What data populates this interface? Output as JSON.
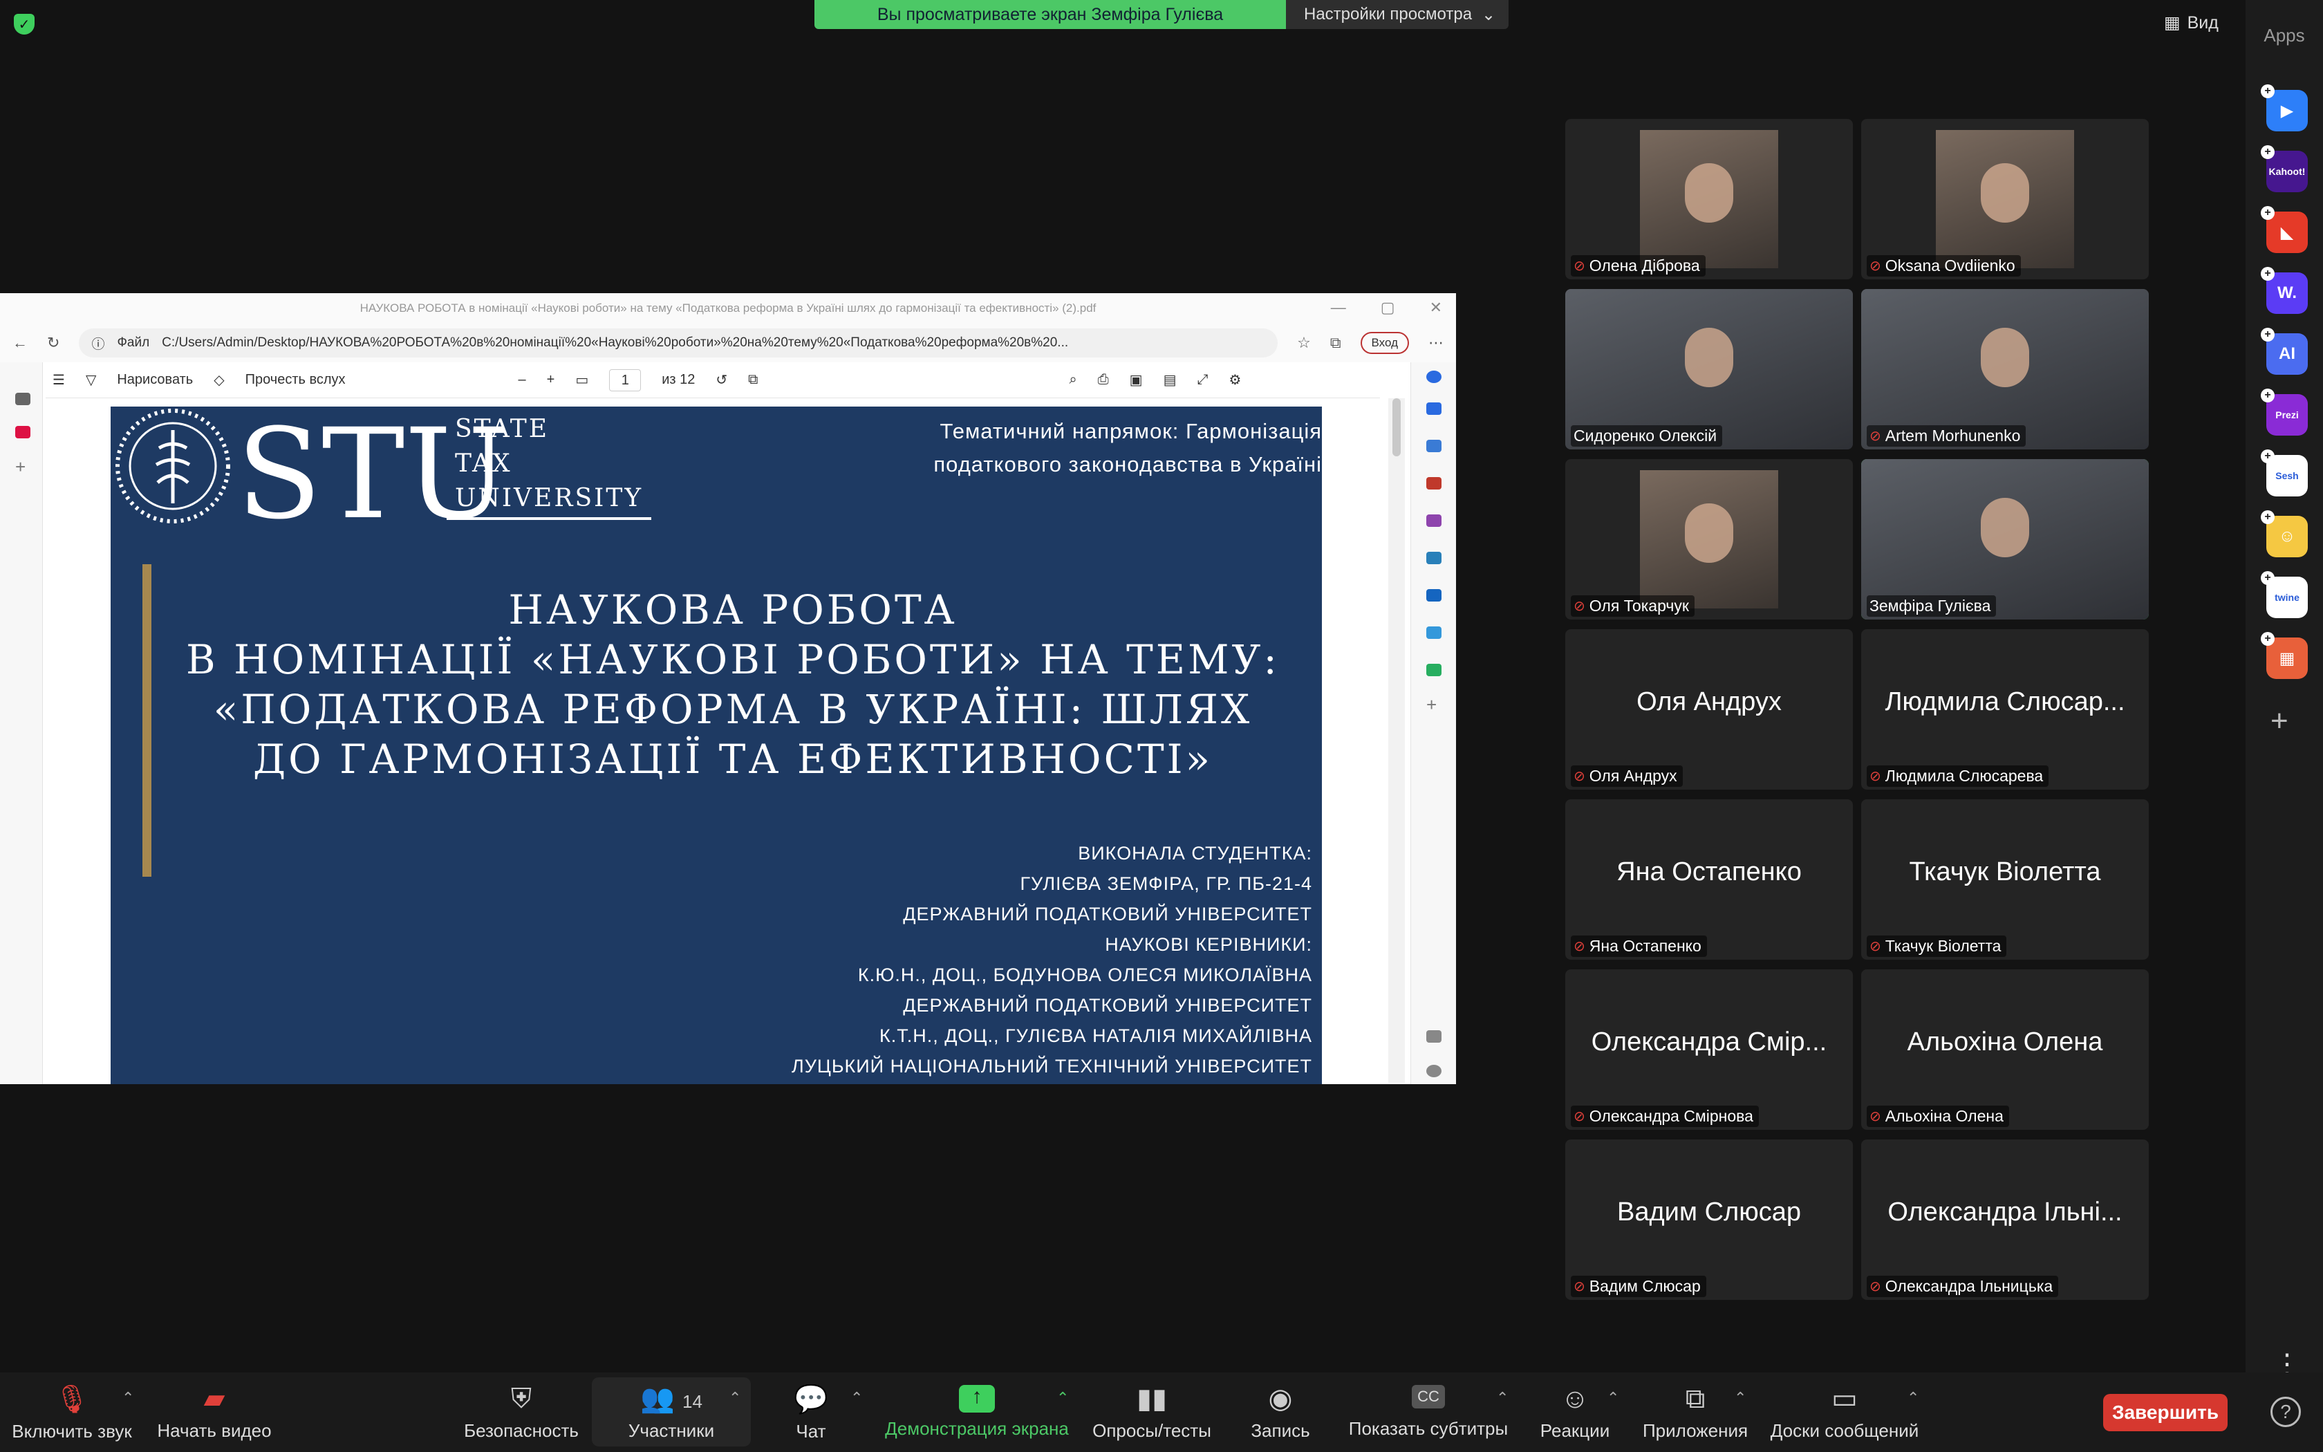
{
  "banner": {
    "message": "Вы просматриваете экран Земфіра Гулієва",
    "view_options": "Настройки просмотра"
  },
  "top_right": {
    "view_label": "Вид"
  },
  "apps": {
    "title": "Apps",
    "items": [
      {
        "name": "pitch",
        "label": "▶",
        "color": "#2d7ff9"
      },
      {
        "name": "kahoot",
        "label": "Kahoot!",
        "color": "#46178f"
      },
      {
        "name": "red-app",
        "label": "◣",
        "color": "#e53a28"
      },
      {
        "name": "wordwall",
        "label": "W.",
        "color": "#5b3cf5"
      },
      {
        "name": "ai-app",
        "label": "AI",
        "color": "#4b6cf0"
      },
      {
        "name": "prezi",
        "label": "Prezi",
        "color": "#8a2bd6"
      },
      {
        "name": "sesh",
        "label": "Sesh",
        "color": "#ffffff"
      },
      {
        "name": "emoji-app",
        "label": "☺",
        "color": "#f5c842"
      },
      {
        "name": "twine",
        "label": "twine",
        "color": "#ffffff"
      },
      {
        "name": "multi-app",
        "label": "▦",
        "color": "#e8603a"
      }
    ]
  },
  "browser": {
    "title": "НАУКОВА РОБОТА в номінації «Наукові роботи» на тему «Податкова реформа в Україні шлях до гармонізації та ефективності» (2).pdf",
    "file_label": "Файл",
    "url": "C:/Users/Admin/Desktop/НАУКОВА%20РОБОТА%20в%20номінації%20«Наукові%20роботи»%20на%20тему%20«Податкова%20реформа%20в%20...",
    "login": "Вход",
    "toolbar": {
      "draw": "Нарисовать",
      "read_aloud": "Прочесть вслух",
      "page": "1",
      "page_total": "из 12",
      "minus": "–",
      "plus": "+"
    }
  },
  "slide": {
    "logo": {
      "letters": "STU",
      "line1": "STATE",
      "line2": "TAX",
      "line3": "UNIVERSITY"
    },
    "topic": [
      "Тематичний напрямок: Гармонізація",
      "податкового законодавства в Україні"
    ],
    "heading": [
      "НАУКОВА РОБОТА",
      "В НОМІНАЦІЇ «НАУКОВІ РОБОТИ» НА ТЕМУ:",
      "«ПОДАТКОВА РЕФОРМА В УКРАЇНІ: ШЛЯХ",
      "ДО ГАРМОНІЗАЦІЇ ТА ЕФЕКТИВНОСТІ»"
    ],
    "authors": [
      "ВИКОНАЛА СТУДЕНТКА:",
      "ГУЛІЄВА ЗЕМФІРА, ГР. ПБ-21-4",
      "ДЕРЖАВНИЙ ПОДАТКОВИЙ УНІВЕРСИТЕТ",
      "НАУКОВІ КЕРІВНИКИ:",
      "К.Ю.Н., ДОЦ., БОДУНОВА ОЛЕСЯ МИКОЛАЇВНА",
      "ДЕРЖАВНИЙ ПОДАТКОВИЙ УНІВЕРСИТЕТ",
      "К.Т.Н., ДОЦ., ГУЛІЄВА НАТАЛІЯ МИХАЙЛІВНА",
      "ЛУЦЬКИЙ НАЦІОНАЛЬНИЙ ТЕХНІЧНИЙ УНІВЕРСИТЕТ"
    ]
  },
  "participants": [
    {
      "name": "Олена Діброва",
      "video": true,
      "muted": true
    },
    {
      "name": "Oksana Ovdiienko",
      "video": true,
      "muted": true
    },
    {
      "name": "Сидоренко Олексій",
      "video": true,
      "muted": false
    },
    {
      "name": "Artem Morhunenko",
      "video": true,
      "muted": true
    },
    {
      "name": "Оля Токарчук",
      "video": true,
      "muted": true
    },
    {
      "name": "Земфіра Гулієва",
      "video": true,
      "muted": false,
      "active": true
    },
    {
      "name": "Оля Андрух",
      "big": "Оля Андрух",
      "video": false,
      "muted": true
    },
    {
      "name": "Людмила Слюсарева",
      "big": "Людмила Слюсар...",
      "video": false,
      "muted": true
    },
    {
      "name": "Яна Остапенко",
      "big": "Яна Остапенко",
      "video": false,
      "muted": true
    },
    {
      "name": "Ткачук Віолетта",
      "big": "Ткачук Віолетта",
      "video": false,
      "muted": true
    },
    {
      "name": "Олександра Смірнова",
      "big": "Олександра Смір...",
      "video": false,
      "muted": true
    },
    {
      "name": "Альохіна Олена",
      "big": "Альохіна Олена",
      "video": false,
      "muted": true
    },
    {
      "name": "Вадим Слюсар",
      "big": "Вадим Слюсар",
      "video": false,
      "muted": true
    },
    {
      "name": "Олександра Ільницька",
      "big": "Олександра Ільні...",
      "video": false,
      "muted": true
    }
  ],
  "controls": {
    "unmute": "Включить звук",
    "start_video": "Начать видео",
    "security": "Безопасность",
    "participants": "Участники",
    "participants_count": "14",
    "chat": "Чат",
    "share": "Демонстрация экрана",
    "polls": "Опросы/тесты",
    "record": "Запись",
    "captions": "Показать субтитры",
    "captions_badge": "CC",
    "reactions": "Реакции",
    "apps": "Приложения",
    "whiteboards": "Доски сообщений",
    "end": "Завершить",
    "help": "?"
  },
  "colors": {
    "accent_green": "#4cc866",
    "slide_bg": "#1e3a63",
    "end_red": "#d6382f"
  }
}
